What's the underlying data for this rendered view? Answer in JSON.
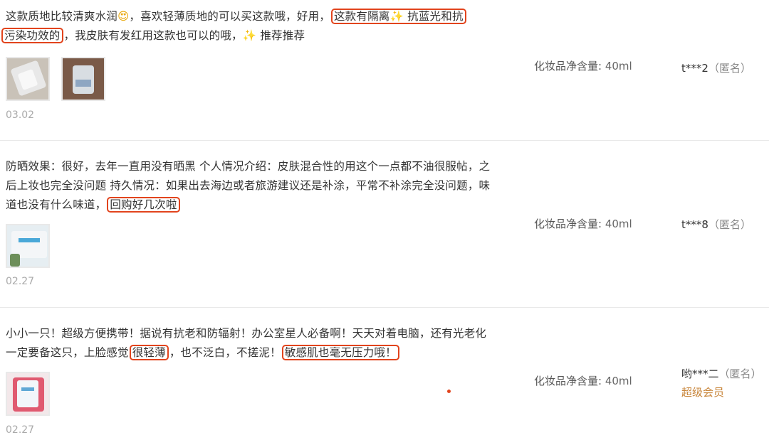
{
  "reviews": [
    {
      "text": {
        "p1": "这款质地比较清爽水润",
        "emoji": "😍",
        "p2": "，喜欢轻薄质地的可以买这款哦，好用，",
        "hl1": "这款有隔离",
        "spark1": "✨",
        "hl1b": "抗蓝光和抗",
        "hl2": "污染功效的",
        "p3": "，我皮肤有发红用这款也可以的哦，",
        "spark2": "✨",
        "p4": "推荐推荐"
      },
      "thumbnail_count": 2,
      "date": "03.02",
      "spec_label": "化妆品净含量:",
      "spec_value": "40ml",
      "user": "t***2",
      "anon": "（匿名）"
    },
    {
      "text": {
        "p1": "防晒效果：很好，去年一直用没有晒黑 个人情况介绍：皮肤混合性的用这个一点都不油很服帖，之后上妆也完全没问题 持久情况：如果出去海边或者旅游建议还是补涂，平常不补涂完全没问题，味道也没有什么味道，",
        "hl1": "回购好几次啦"
      },
      "thumbnail_count": 1,
      "date": "02.27",
      "spec_label": "化妆品净含量:",
      "spec_value": "40ml",
      "user": "t***8",
      "anon": "（匿名）"
    },
    {
      "text": {
        "p1": "小小一只！超级方便携带！据说有抗老和防辐射！办公室星人必备啊！天天对着电脑，还有光老化 一定要备这只，上脸感觉",
        "hl1": "很轻薄",
        "p2": "，也不泛白，不搓泥！",
        "hl2": "敏感肌也毫无压力哦！"
      },
      "thumbnail_count": 1,
      "date": "02.27",
      "spec_label": "化妆品净含量:",
      "spec_value": "40ml",
      "user": "哟***二",
      "anon": "（匿名）",
      "badge": "超级会员"
    }
  ],
  "colors": {
    "highlight": "#e2441d",
    "vip": "#c8853a",
    "date": "#aaaaaa"
  }
}
